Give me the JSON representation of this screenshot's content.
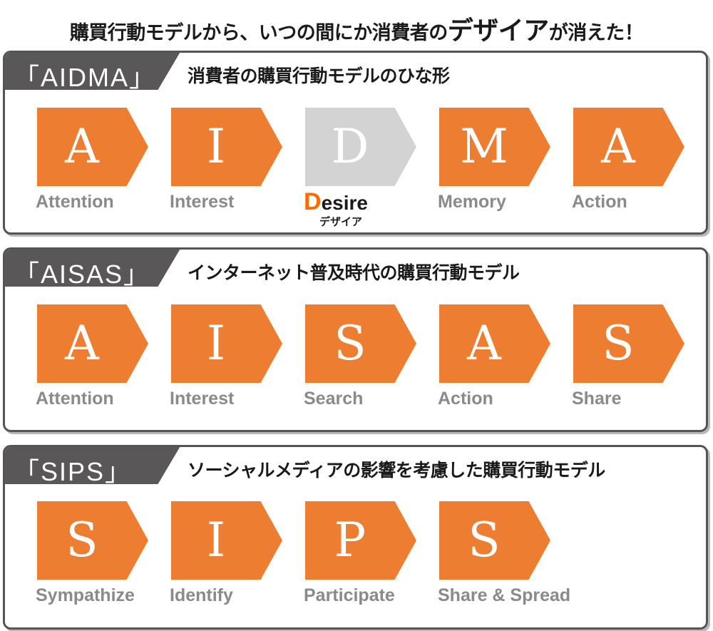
{
  "title": {
    "before": "購買行動モデルから、いつの間にか消費者の",
    "emphasis": "デザイア",
    "after": "が消えた！"
  },
  "colors": {
    "accent": "#ED7D31",
    "muted": "#D3D3D3",
    "tab_bg": "#595757",
    "label_text": "#8A8A8A",
    "desire_highlight": "#FF6A00"
  },
  "models": [
    {
      "name": "「AIDMA」",
      "description": "消費者の購買行動モデルのひな形",
      "steps": [
        {
          "letter": "A",
          "label": "Attention",
          "state": "active"
        },
        {
          "letter": "I",
          "label": "Interest",
          "state": "active"
        },
        {
          "letter": "D",
          "label_first": "D",
          "label_rest": "esire",
          "label_sub": "デザイア",
          "state": "faded"
        },
        {
          "letter": "M",
          "label": "Memory",
          "state": "active"
        },
        {
          "letter": "A",
          "label": "Action",
          "state": "active"
        }
      ]
    },
    {
      "name": "「AISAS」",
      "description": "インターネット普及時代の購買行動モデル",
      "steps": [
        {
          "letter": "A",
          "label": "Attention",
          "state": "active"
        },
        {
          "letter": "I",
          "label": "Interest",
          "state": "active"
        },
        {
          "letter": "S",
          "label": "Search",
          "state": "active"
        },
        {
          "letter": "A",
          "label": "Action",
          "state": "active"
        },
        {
          "letter": "S",
          "label": "Share",
          "state": "active"
        }
      ]
    },
    {
      "name": "「SIPS」",
      "description": "ソーシャルメディアの影響を考慮した購買行動モデル",
      "steps": [
        {
          "letter": "S",
          "label": "Sympathize",
          "state": "active"
        },
        {
          "letter": "I",
          "label": "Identify",
          "state": "active"
        },
        {
          "letter": "P",
          "label": "Participate",
          "state": "active"
        },
        {
          "letter": "S",
          "label": "Share & Spread",
          "state": "active"
        }
      ]
    }
  ]
}
